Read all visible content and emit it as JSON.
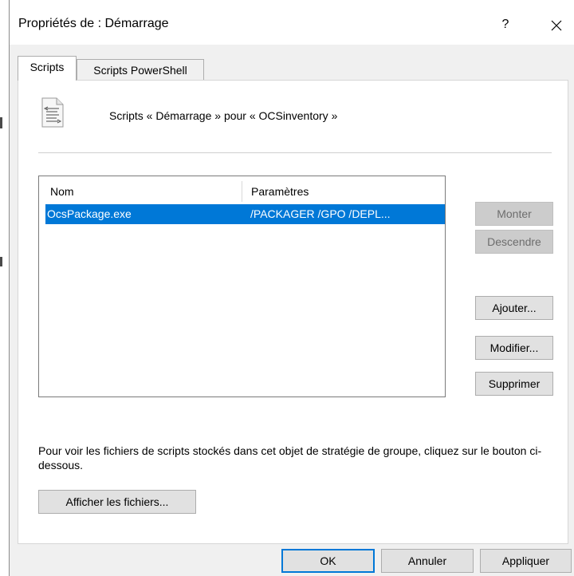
{
  "dialog": {
    "title": "Propriétés de : Démarrage",
    "help_label": "?",
    "close_label": "✕"
  },
  "tabs": [
    {
      "label": "Scripts",
      "active": true
    },
    {
      "label": "Scripts PowerShell",
      "active": false
    }
  ],
  "scripts_tab": {
    "icon": "script-document-icon",
    "heading": "Scripts « Démarrage » pour « OCSinventory »",
    "list": {
      "columns": [
        "Nom",
        "Paramètres"
      ],
      "rows": [
        {
          "name": "OcsPackage.exe",
          "params": "/PACKAGER /GPO /DEPL...",
          "selected": true
        }
      ]
    },
    "buttons": {
      "up": "Monter",
      "down": "Descendre",
      "add": "Ajouter...",
      "edit": "Modifier...",
      "remove": "Supprimer"
    },
    "note": "Pour voir les fichiers de scripts stockés dans cet objet de stratégie de groupe, cliquez sur le bouton ci-dessous.",
    "show_files": "Afficher les fichiers..."
  },
  "footer": {
    "ok": "OK",
    "cancel": "Annuler",
    "apply": "Appliquer"
  },
  "colors": {
    "selection": "#0078d7",
    "default_border": "#0078d7",
    "dialog_bg": "#f0f0f0"
  }
}
